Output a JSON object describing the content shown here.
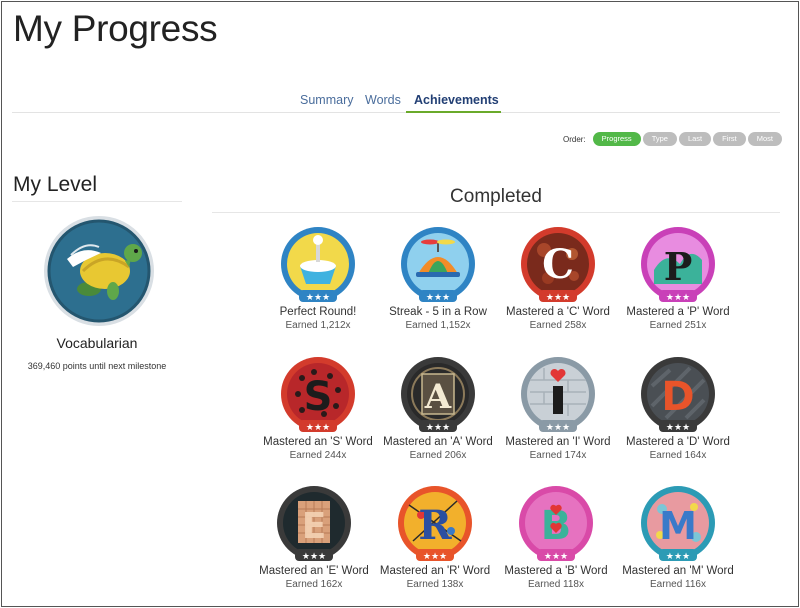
{
  "page": {
    "title": "My Progress"
  },
  "tabs": [
    {
      "label": "Summary"
    },
    {
      "label": "Words"
    },
    {
      "label": "Achievements"
    }
  ],
  "order": {
    "label": "Order:",
    "options": [
      "Progress",
      "Type",
      "Last",
      "First",
      "Most"
    ],
    "selected": "Progress"
  },
  "level": {
    "heading": "My Level",
    "name": "Vocabularian",
    "points_text": "369,460 points until next milestone"
  },
  "completed": {
    "heading": "Completed",
    "stars": "★★★",
    "items": [
      {
        "name": "Perfect Round!",
        "earned": "Earned 1,212x",
        "icon": "ice-cream-icon",
        "color": "#2f84c4"
      },
      {
        "name": "Streak - 5 in a Row",
        "earned": "Earned 1,152x",
        "icon": "propeller-hat-icon",
        "color": "#2f84c4"
      },
      {
        "name": "Mastered a 'C' Word",
        "earned": "Earned 258x",
        "icon": "letter-c-icon",
        "color": "#d33b2c"
      },
      {
        "name": "Mastered a 'P' Word",
        "earned": "Earned 251x",
        "icon": "letter-p-icon",
        "color": "#c940b8"
      },
      {
        "name": "Mastered an 'S' Word",
        "earned": "Earned 244x",
        "icon": "letter-s-icon",
        "color": "#d33b2c"
      },
      {
        "name": "Mastered an 'A' Word",
        "earned": "Earned 206x",
        "icon": "letter-a-icon",
        "color": "#3a3a3a"
      },
      {
        "name": "Mastered an 'I' Word",
        "earned": "Earned 174x",
        "icon": "letter-i-icon",
        "color": "#8a9aa6"
      },
      {
        "name": "Mastered a 'D' Word",
        "earned": "Earned 164x",
        "icon": "letter-d-icon",
        "color": "#3a3a3a"
      },
      {
        "name": "Mastered an 'E' Word",
        "earned": "Earned 162x",
        "icon": "letter-e-icon",
        "color": "#3a3a3a"
      },
      {
        "name": "Mastered an 'R' Word",
        "earned": "Earned 138x",
        "icon": "letter-r-icon",
        "color": "#e8542a"
      },
      {
        "name": "Mastered a 'B' Word",
        "earned": "Earned 118x",
        "icon": "letter-b-icon",
        "color": "#d94aa8"
      },
      {
        "name": "Mastered an 'M' Word",
        "earned": "Earned 116x",
        "icon": "letter-m-icon",
        "color": "#2c9bb5"
      }
    ]
  }
}
